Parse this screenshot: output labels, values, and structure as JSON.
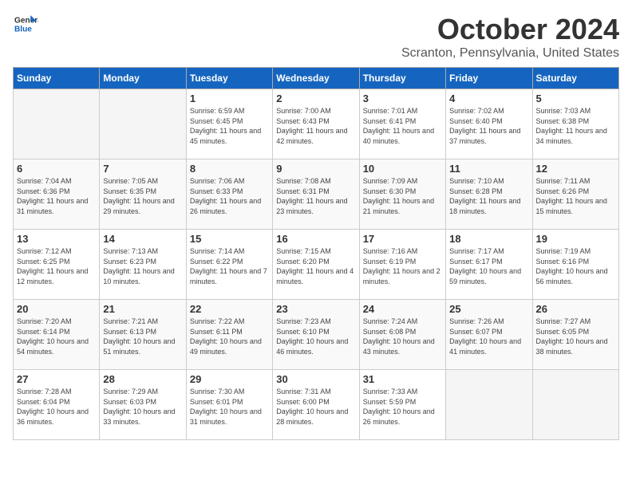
{
  "header": {
    "logo_general": "General",
    "logo_blue": "Blue",
    "month": "October 2024",
    "location": "Scranton, Pennsylvania, United States"
  },
  "weekdays": [
    "Sunday",
    "Monday",
    "Tuesday",
    "Wednesday",
    "Thursday",
    "Friday",
    "Saturday"
  ],
  "weeks": [
    [
      null,
      null,
      {
        "day": "1",
        "sunrise": "Sunrise: 6:59 AM",
        "sunset": "Sunset: 6:45 PM",
        "daylight": "Daylight: 11 hours and 45 minutes."
      },
      {
        "day": "2",
        "sunrise": "Sunrise: 7:00 AM",
        "sunset": "Sunset: 6:43 PM",
        "daylight": "Daylight: 11 hours and 42 minutes."
      },
      {
        "day": "3",
        "sunrise": "Sunrise: 7:01 AM",
        "sunset": "Sunset: 6:41 PM",
        "daylight": "Daylight: 11 hours and 40 minutes."
      },
      {
        "day": "4",
        "sunrise": "Sunrise: 7:02 AM",
        "sunset": "Sunset: 6:40 PM",
        "daylight": "Daylight: 11 hours and 37 minutes."
      },
      {
        "day": "5",
        "sunrise": "Sunrise: 7:03 AM",
        "sunset": "Sunset: 6:38 PM",
        "daylight": "Daylight: 11 hours and 34 minutes."
      }
    ],
    [
      {
        "day": "6",
        "sunrise": "Sunrise: 7:04 AM",
        "sunset": "Sunset: 6:36 PM",
        "daylight": "Daylight: 11 hours and 31 minutes."
      },
      {
        "day": "7",
        "sunrise": "Sunrise: 7:05 AM",
        "sunset": "Sunset: 6:35 PM",
        "daylight": "Daylight: 11 hours and 29 minutes."
      },
      {
        "day": "8",
        "sunrise": "Sunrise: 7:06 AM",
        "sunset": "Sunset: 6:33 PM",
        "daylight": "Daylight: 11 hours and 26 minutes."
      },
      {
        "day": "9",
        "sunrise": "Sunrise: 7:08 AM",
        "sunset": "Sunset: 6:31 PM",
        "daylight": "Daylight: 11 hours and 23 minutes."
      },
      {
        "day": "10",
        "sunrise": "Sunrise: 7:09 AM",
        "sunset": "Sunset: 6:30 PM",
        "daylight": "Daylight: 11 hours and 21 minutes."
      },
      {
        "day": "11",
        "sunrise": "Sunrise: 7:10 AM",
        "sunset": "Sunset: 6:28 PM",
        "daylight": "Daylight: 11 hours and 18 minutes."
      },
      {
        "day": "12",
        "sunrise": "Sunrise: 7:11 AM",
        "sunset": "Sunset: 6:26 PM",
        "daylight": "Daylight: 11 hours and 15 minutes."
      }
    ],
    [
      {
        "day": "13",
        "sunrise": "Sunrise: 7:12 AM",
        "sunset": "Sunset: 6:25 PM",
        "daylight": "Daylight: 11 hours and 12 minutes."
      },
      {
        "day": "14",
        "sunrise": "Sunrise: 7:13 AM",
        "sunset": "Sunset: 6:23 PM",
        "daylight": "Daylight: 11 hours and 10 minutes."
      },
      {
        "day": "15",
        "sunrise": "Sunrise: 7:14 AM",
        "sunset": "Sunset: 6:22 PM",
        "daylight": "Daylight: 11 hours and 7 minutes."
      },
      {
        "day": "16",
        "sunrise": "Sunrise: 7:15 AM",
        "sunset": "Sunset: 6:20 PM",
        "daylight": "Daylight: 11 hours and 4 minutes."
      },
      {
        "day": "17",
        "sunrise": "Sunrise: 7:16 AM",
        "sunset": "Sunset: 6:19 PM",
        "daylight": "Daylight: 11 hours and 2 minutes."
      },
      {
        "day": "18",
        "sunrise": "Sunrise: 7:17 AM",
        "sunset": "Sunset: 6:17 PM",
        "daylight": "Daylight: 10 hours and 59 minutes."
      },
      {
        "day": "19",
        "sunrise": "Sunrise: 7:19 AM",
        "sunset": "Sunset: 6:16 PM",
        "daylight": "Daylight: 10 hours and 56 minutes."
      }
    ],
    [
      {
        "day": "20",
        "sunrise": "Sunrise: 7:20 AM",
        "sunset": "Sunset: 6:14 PM",
        "daylight": "Daylight: 10 hours and 54 minutes."
      },
      {
        "day": "21",
        "sunrise": "Sunrise: 7:21 AM",
        "sunset": "Sunset: 6:13 PM",
        "daylight": "Daylight: 10 hours and 51 minutes."
      },
      {
        "day": "22",
        "sunrise": "Sunrise: 7:22 AM",
        "sunset": "Sunset: 6:11 PM",
        "daylight": "Daylight: 10 hours and 49 minutes."
      },
      {
        "day": "23",
        "sunrise": "Sunrise: 7:23 AM",
        "sunset": "Sunset: 6:10 PM",
        "daylight": "Daylight: 10 hours and 46 minutes."
      },
      {
        "day": "24",
        "sunrise": "Sunrise: 7:24 AM",
        "sunset": "Sunset: 6:08 PM",
        "daylight": "Daylight: 10 hours and 43 minutes."
      },
      {
        "day": "25",
        "sunrise": "Sunrise: 7:26 AM",
        "sunset": "Sunset: 6:07 PM",
        "daylight": "Daylight: 10 hours and 41 minutes."
      },
      {
        "day": "26",
        "sunrise": "Sunrise: 7:27 AM",
        "sunset": "Sunset: 6:05 PM",
        "daylight": "Daylight: 10 hours and 38 minutes."
      }
    ],
    [
      {
        "day": "27",
        "sunrise": "Sunrise: 7:28 AM",
        "sunset": "Sunset: 6:04 PM",
        "daylight": "Daylight: 10 hours and 36 minutes."
      },
      {
        "day": "28",
        "sunrise": "Sunrise: 7:29 AM",
        "sunset": "Sunset: 6:03 PM",
        "daylight": "Daylight: 10 hours and 33 minutes."
      },
      {
        "day": "29",
        "sunrise": "Sunrise: 7:30 AM",
        "sunset": "Sunset: 6:01 PM",
        "daylight": "Daylight: 10 hours and 31 minutes."
      },
      {
        "day": "30",
        "sunrise": "Sunrise: 7:31 AM",
        "sunset": "Sunset: 6:00 PM",
        "daylight": "Daylight: 10 hours and 28 minutes."
      },
      {
        "day": "31",
        "sunrise": "Sunrise: 7:33 AM",
        "sunset": "Sunset: 5:59 PM",
        "daylight": "Daylight: 10 hours and 26 minutes."
      },
      null,
      null
    ]
  ]
}
